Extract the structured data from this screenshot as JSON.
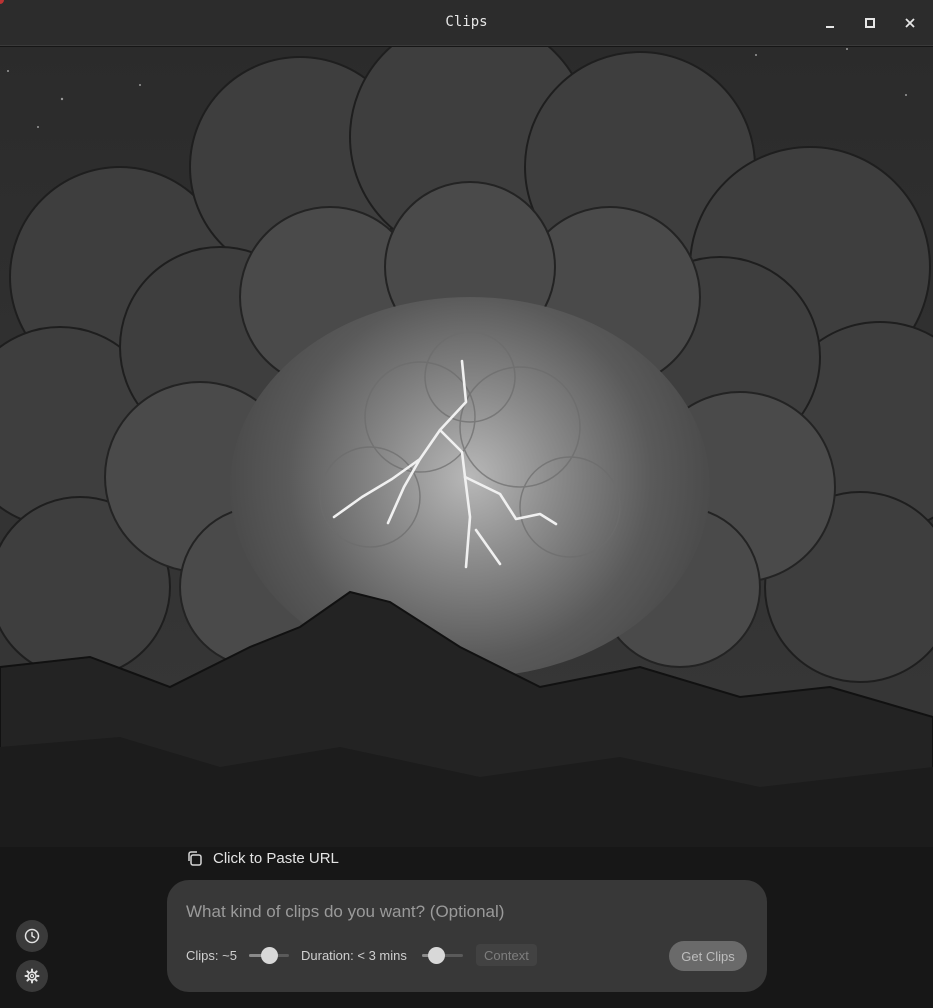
{
  "window": {
    "title": "Clips",
    "controls": [
      "minimize-icon",
      "maximize-icon",
      "close-icon"
    ]
  },
  "paste": {
    "icon": "copy-icon",
    "label": "Click to Paste URL"
  },
  "prompt": {
    "placeholder": "What kind of clips do you want? (Optional)",
    "value": ""
  },
  "controls": {
    "clips_label": "Clips: ~5",
    "clips_level": 0.5,
    "duration_label": "Duration: < 3 mins",
    "duration_level": 0.25,
    "context_label": "Context",
    "submit_label": "Get Clips"
  },
  "sidebar": {
    "history_icon": "clock-icon",
    "settings_icon": "gear-icon"
  },
  "colors": {
    "accent_muted": "#6a6a6a",
    "panel": "#3a3a3a",
    "background": "#161616"
  }
}
